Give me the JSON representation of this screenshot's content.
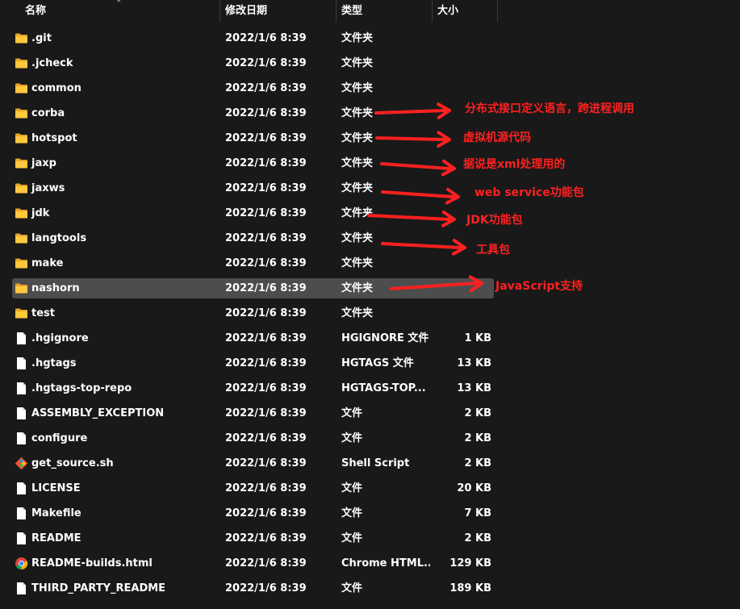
{
  "columns": {
    "name": "名称",
    "date": "修改日期",
    "type": "类型",
    "size": "大小"
  },
  "colors": {
    "annotation": "#ff2020",
    "folder": "#ffc83d",
    "selected_row": "#4d4d4d"
  },
  "rows": [
    {
      "name": ".git",
      "date": "2022/1/6 8:39",
      "type": "文件夹",
      "size": "",
      "icon": "folder-icon"
    },
    {
      "name": ".jcheck",
      "date": "2022/1/6 8:39",
      "type": "文件夹",
      "size": "",
      "icon": "folder-icon"
    },
    {
      "name": "common",
      "date": "2022/1/6 8:39",
      "type": "文件夹",
      "size": "",
      "icon": "folder-icon"
    },
    {
      "name": "corba",
      "date": "2022/1/6 8:39",
      "type": "文件夹",
      "size": "",
      "icon": "folder-icon"
    },
    {
      "name": "hotspot",
      "date": "2022/1/6 8:39",
      "type": "文件夹",
      "size": "",
      "icon": "folder-icon"
    },
    {
      "name": "jaxp",
      "date": "2022/1/6 8:39",
      "type": "文件夹",
      "size": "",
      "icon": "folder-icon"
    },
    {
      "name": "jaxws",
      "date": "2022/1/6 8:39",
      "type": "文件夹",
      "size": "",
      "icon": "folder-icon"
    },
    {
      "name": "jdk",
      "date": "2022/1/6 8:39",
      "type": "文件夹",
      "size": "",
      "icon": "folder-icon"
    },
    {
      "name": "langtools",
      "date": "2022/1/6 8:39",
      "type": "文件夹",
      "size": "",
      "icon": "folder-icon"
    },
    {
      "name": "make",
      "date": "2022/1/6 8:39",
      "type": "文件夹",
      "size": "",
      "icon": "folder-icon"
    },
    {
      "name": "nashorn",
      "date": "2022/1/6 8:39",
      "type": "文件夹",
      "size": "",
      "icon": "folder-icon",
      "selected": true
    },
    {
      "name": "test",
      "date": "2022/1/6 8:39",
      "type": "文件夹",
      "size": "",
      "icon": "folder-icon"
    },
    {
      "name": ".hgignore",
      "date": "2022/1/6 8:39",
      "type": "HGIGNORE 文件",
      "size": "1 KB",
      "icon": "file-icon"
    },
    {
      "name": ".hgtags",
      "date": "2022/1/6 8:39",
      "type": "HGTAGS 文件",
      "size": "13 KB",
      "icon": "file-icon"
    },
    {
      "name": ".hgtags-top-repo",
      "date": "2022/1/6 8:39",
      "type": "HGTAGS-TOP...",
      "size": "13 KB",
      "icon": "file-icon"
    },
    {
      "name": "ASSEMBLY_EXCEPTION",
      "date": "2022/1/6 8:39",
      "type": "文件",
      "size": "2 KB",
      "icon": "file-icon"
    },
    {
      "name": "configure",
      "date": "2022/1/6 8:39",
      "type": "文件",
      "size": "2 KB",
      "icon": "file-icon"
    },
    {
      "name": "get_source.sh",
      "date": "2022/1/6 8:39",
      "type": "Shell Script",
      "size": "2 KB",
      "icon": "git-script-icon"
    },
    {
      "name": "LICENSE",
      "date": "2022/1/6 8:39",
      "type": "文件",
      "size": "20 KB",
      "icon": "file-icon"
    },
    {
      "name": "Makefile",
      "date": "2022/1/6 8:39",
      "type": "文件",
      "size": "7 KB",
      "icon": "file-icon"
    },
    {
      "name": "README",
      "date": "2022/1/6 8:39",
      "type": "文件",
      "size": "2 KB",
      "icon": "file-icon"
    },
    {
      "name": "README-builds.html",
      "date": "2022/1/6 8:39",
      "type": "Chrome HTML...",
      "size": "129 KB",
      "icon": "chrome-icon"
    },
    {
      "name": "THIRD_PARTY_README",
      "date": "2022/1/6 8:39",
      "type": "文件",
      "size": "189 KB",
      "icon": "file-icon"
    }
  ],
  "annotations": [
    {
      "row": "corba",
      "text": "分布式接口定义语言，跨进程调用"
    },
    {
      "row": "hotspot",
      "text": "虚拟机源代码"
    },
    {
      "row": "jaxp",
      "text": "据说是xml处理用的"
    },
    {
      "row": "jaxws",
      "text": "web service功能包"
    },
    {
      "row": "jdk",
      "text": "JDK功能包"
    },
    {
      "row": "langtools",
      "text": "工具包"
    },
    {
      "row": "nashorn",
      "text": "JavaScript支持"
    }
  ]
}
